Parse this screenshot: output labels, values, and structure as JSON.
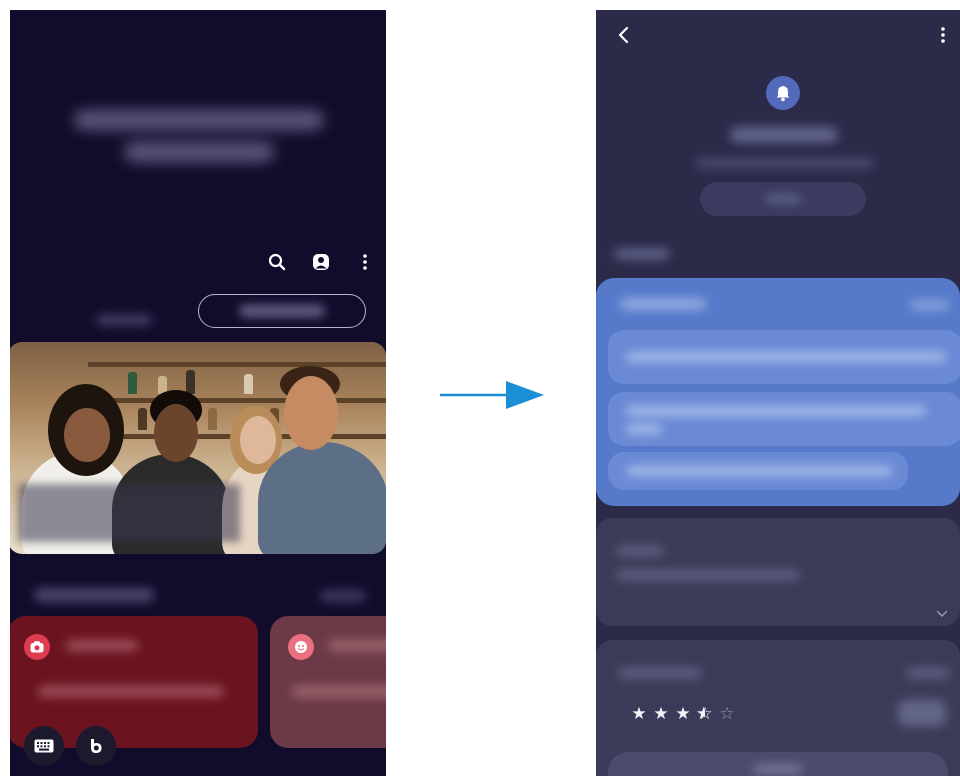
{
  "left_screen": {
    "toolbar": {
      "search_icon": "search-icon",
      "profile_icon": "profile-icon",
      "more_icon": "more-vertical-icon"
    },
    "cards": {
      "red_card_icon": "camera-icon",
      "rose_card_icon": "face-icon"
    },
    "floating_buttons": [
      "keyboard-icon",
      "bixby-icon"
    ]
  },
  "right_screen": {
    "header": {
      "back_icon": "back-arrow-icon",
      "more_icon": "more-vertical-icon",
      "app_icon": "bell-icon"
    },
    "rating": {
      "stars_filled": 3.5,
      "stars_total": 5
    }
  },
  "colors": {
    "left_background": "#120c2c",
    "right_background": "#2b2a49",
    "blue_panel": "#5679c9",
    "red_card": "#6b1420",
    "arrow": "#1b8fd6"
  }
}
